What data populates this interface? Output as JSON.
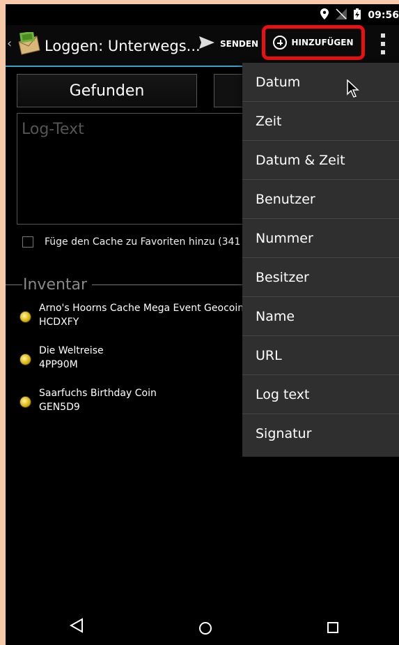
{
  "status_bar": {
    "time": "09:56"
  },
  "action_bar": {
    "title": "Loggen: Unterwegs...",
    "send_label": "SENDEN",
    "add_label": "HINZUFÜGEN"
  },
  "form": {
    "log_type": "Gefunden",
    "log_text_placeholder": "Log-Text",
    "favorite_label": "Füge den Cache zu Favoriten hinzu (341"
  },
  "inventory": {
    "title": "Inventar",
    "items": [
      {
        "name": "Arno's Hoorns Cache Mega Event Geocoin",
        "code": "HCDXFY"
      },
      {
        "name": "Die Weltreise",
        "code": "4PP90M"
      },
      {
        "name": "Saarfuchs Birthday Coin",
        "code": "GEN5D9"
      }
    ]
  },
  "menu": {
    "items": [
      "Datum",
      "Zeit",
      "Datum & Zeit",
      "Benutzer",
      "Nummer",
      "Besitzer",
      "Name",
      "URL",
      "Log text",
      "Signatur"
    ]
  },
  "colors": {
    "accent": "#37a2cc",
    "highlight": "#e81010",
    "menu_bg": "#2f2f2f"
  }
}
